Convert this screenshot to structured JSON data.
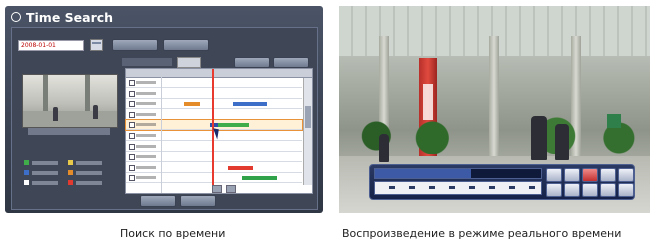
{
  "left_panel": {
    "title": "Time Search",
    "date_value": "2008-01-01",
    "legend": [
      {
        "color": "#3fae4a"
      },
      {
        "color": "#e9c94a"
      },
      {
        "color": "#3d6fc9"
      },
      {
        "color": "#e48c2a"
      },
      {
        "color": "#ffffff"
      },
      {
        "color": "#e33a2f"
      }
    ],
    "record_bars": [
      {
        "row": 2,
        "start": 0.16,
        "end": 0.27,
        "color": "#e48c2a"
      },
      {
        "row": 2,
        "start": 0.51,
        "end": 0.75,
        "color": "#3d6fc9"
      },
      {
        "row": 4,
        "start": 0.38,
        "end": 0.62,
        "color": "#3fae4a"
      },
      {
        "row": 4,
        "start": 0.34,
        "end": 0.4,
        "color": "#2c4fa8"
      },
      {
        "row": 8,
        "start": 0.47,
        "end": 0.65,
        "color": "#e33a2f"
      },
      {
        "row": 9,
        "start": 0.57,
        "end": 0.82,
        "color": "#2fa24a"
      }
    ],
    "selected_row": 4,
    "channel_count": 10
  },
  "captions": {
    "left": "Поиск по времени",
    "right": "Воспроизведение в режиме реального времени"
  }
}
